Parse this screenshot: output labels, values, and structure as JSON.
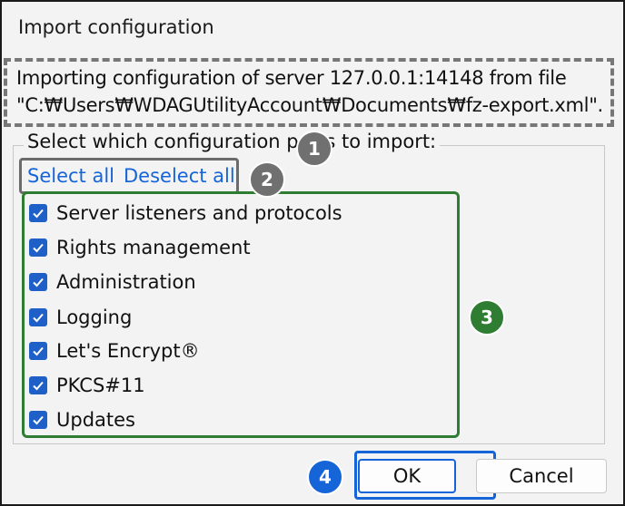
{
  "dialog": {
    "title": "Import configuration",
    "info_line1": "Importing configuration of server 127.0.0.1:14148 from file",
    "info_line2": "\"C:₩Users₩WDAGUtilityAccount₩Documents₩fz-export.xml\".",
    "group_label": "Select which configuration parts to import:",
    "select_all": "Select all",
    "deselect_all": "Deselect all",
    "parts": [
      {
        "label": "Server listeners and protocols",
        "checked": true
      },
      {
        "label": "Rights management",
        "checked": true
      },
      {
        "label": "Administration",
        "checked": true
      },
      {
        "label": "Logging",
        "checked": true
      },
      {
        "label": "Let's Encrypt®",
        "checked": true
      },
      {
        "label": "PKCS#11",
        "checked": true
      },
      {
        "label": "Updates",
        "checked": true
      }
    ],
    "ok_label": "OK",
    "cancel_label": "Cancel"
  },
  "annotations": [
    {
      "number": "1",
      "color": "#707070"
    },
    {
      "number": "2",
      "color": "#707070"
    },
    {
      "number": "3",
      "color": "#2e7d32"
    },
    {
      "number": "4",
      "color": "#1565d8"
    }
  ]
}
